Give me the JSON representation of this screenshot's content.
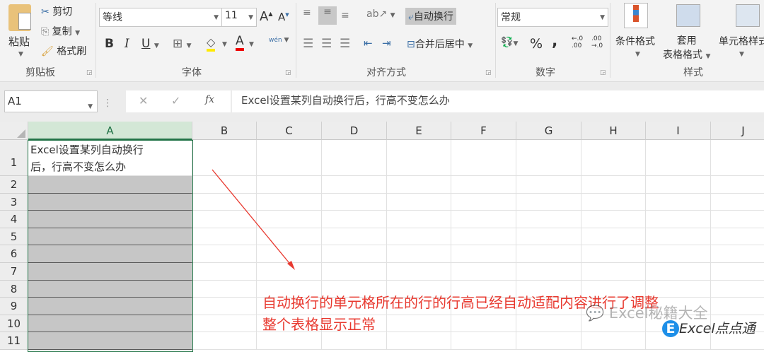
{
  "ribbon": {
    "clipboard": {
      "paste": "粘贴",
      "cut": "剪切",
      "copy": "复制",
      "format_painter": "格式刷",
      "label": "剪贴板"
    },
    "font": {
      "name": "等线",
      "size": "11",
      "bold": "B",
      "italic": "I",
      "underline": "U",
      "wen": "wén",
      "label": "字体"
    },
    "alignment": {
      "wrap_text": "自动换行",
      "merge_center": "合并后居中",
      "label": "对齐方式"
    },
    "number": {
      "format": "常规",
      "percent": "%",
      "comma": ",",
      "inc_decimal": "←.0 .00",
      "dec_decimal": ".00 →.0",
      "label": "数字"
    },
    "styles": {
      "conditional": "条件格式",
      "table_format_1": "套用",
      "table_format_2": "表格格式",
      "cell_styles": "单元格样式",
      "label": "样式"
    }
  },
  "formula_bar": {
    "name_box": "A1",
    "fx": "fx",
    "content": "Excel设置某列自动换行后，行高不变怎么办"
  },
  "columns": [
    "A",
    "B",
    "C",
    "D",
    "E",
    "F",
    "G",
    "H",
    "I",
    "J"
  ],
  "rows": [
    "1",
    "2",
    "3",
    "4",
    "5",
    "6",
    "7",
    "8",
    "9",
    "10",
    "11"
  ],
  "cell_a1": {
    "line1": "Excel设置某列自动换行",
    "line2": "后，行高不变怎么办"
  },
  "annotation": {
    "line1": "自动换行的单元格所在的行的行高已经自动适配内容进行了调整",
    "line2": "整个表格显示正常",
    "color": "#e8392f"
  },
  "watermark": {
    "wechat": "Excel秘籍大全",
    "brand": "Excel点点通"
  }
}
